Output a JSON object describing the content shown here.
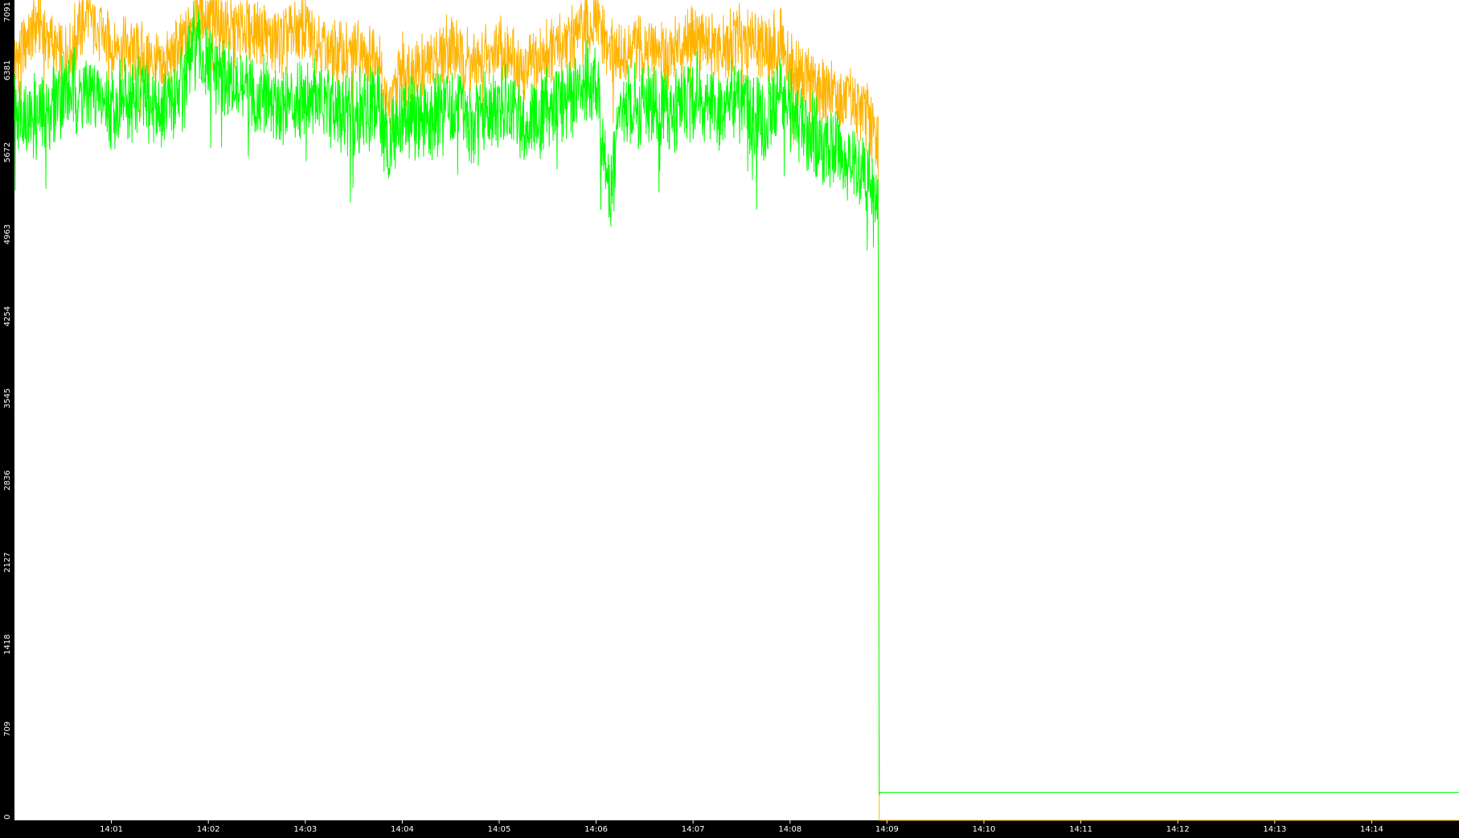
{
  "chart_data": {
    "type": "line",
    "title": "",
    "xlabel": "",
    "ylabel": "",
    "grid": false,
    "legend": "none",
    "xlim_minutes": [
      14.0,
      15.0
    ],
    "ylim": [
      0,
      7091
    ],
    "y_ticks": [
      {
        "value": 0,
        "label": "0"
      },
      {
        "value": 709,
        "label": "709"
      },
      {
        "value": 1418,
        "label": "1418"
      },
      {
        "value": 2127,
        "label": "2127"
      },
      {
        "value": 2836,
        "label": "2836"
      },
      {
        "value": 3545,
        "label": "3545"
      },
      {
        "value": 4254,
        "label": "4254"
      },
      {
        "value": 4963,
        "label": "4963"
      },
      {
        "value": 5672,
        "label": "5672"
      },
      {
        "value": 6381,
        "label": "6381"
      },
      {
        "value": 7091,
        "label": "7091"
      }
    ],
    "x_ticks": [
      {
        "value": 1,
        "label": "14:01"
      },
      {
        "value": 2,
        "label": "14:02"
      },
      {
        "value": 3,
        "label": "14:03"
      },
      {
        "value": 4,
        "label": "14:04"
      },
      {
        "value": 5,
        "label": "14:05"
      },
      {
        "value": 6,
        "label": "14:06"
      },
      {
        "value": 7,
        "label": "14:07"
      },
      {
        "value": 8,
        "label": "14:08"
      },
      {
        "value": 9,
        "label": "14:09"
      },
      {
        "value": 10,
        "label": "14:10"
      },
      {
        "value": 11,
        "label": "14:11"
      },
      {
        "value": 12,
        "label": "14:12"
      },
      {
        "value": 13,
        "label": "14:13"
      },
      {
        "value": 14,
        "label": "14:14"
      }
    ],
    "x_label_prefix": "14:",
    "series": [
      {
        "color": "#ffb400",
        "x": [
          0.0,
          0.25,
          0.5,
          0.75,
          1.0,
          1.25,
          1.5,
          1.75,
          1.85,
          2.0,
          2.25,
          2.5,
          2.75,
          3.0,
          3.25,
          3.5,
          3.75,
          3.85,
          4.0,
          4.25,
          4.5,
          4.75,
          5.0,
          5.25,
          5.5,
          5.75,
          6.0,
          6.15,
          6.25,
          6.5,
          6.75,
          7.0,
          7.25,
          7.5,
          7.75,
          7.9,
          8.0,
          8.25,
          8.5,
          8.75,
          8.85,
          8.91,
          8.92,
          14.99
        ],
        "y": [
          6550,
          6900,
          6550,
          6950,
          6700,
          6650,
          6500,
          6700,
          7000,
          6950,
          6800,
          6850,
          6700,
          6850,
          6650,
          6600,
          6650,
          6100,
          6500,
          6500,
          6700,
          6500,
          6700,
          6450,
          6650,
          6750,
          6900,
          6650,
          6600,
          6700,
          6600,
          6850,
          6600,
          6800,
          6650,
          6750,
          6500,
          6350,
          6250,
          6150,
          6000,
          5880,
          0,
          0
        ]
      },
      {
        "color": "#00ff00",
        "x": [
          0.0,
          0.25,
          0.5,
          0.75,
          1.0,
          1.25,
          1.5,
          1.75,
          1.85,
          2.0,
          2.25,
          2.5,
          2.75,
          3.0,
          3.25,
          3.5,
          3.75,
          3.85,
          4.0,
          4.25,
          4.5,
          4.75,
          5.0,
          5.25,
          5.5,
          5.75,
          6.0,
          6.15,
          6.25,
          6.5,
          6.75,
          7.0,
          7.25,
          7.5,
          7.75,
          7.9,
          8.0,
          8.25,
          8.5,
          8.75,
          8.85,
          8.91,
          8.915,
          8.92,
          8.93,
          14.99
        ],
        "y": [
          6200,
          6050,
          6300,
          6300,
          6150,
          6250,
          6150,
          6350,
          6700,
          6500,
          6350,
          6250,
          6200,
          6300,
          6150,
          6100,
          6200,
          5800,
          6100,
          6050,
          6200,
          6000,
          6200,
          6000,
          6150,
          6250,
          6400,
          5350,
          6150,
          6200,
          6100,
          6300,
          6100,
          6250,
          6000,
          6350,
          6100,
          5900,
          5800,
          5600,
          5500,
          5400,
          2836,
          220,
          240,
          240
        ]
      }
    ]
  }
}
